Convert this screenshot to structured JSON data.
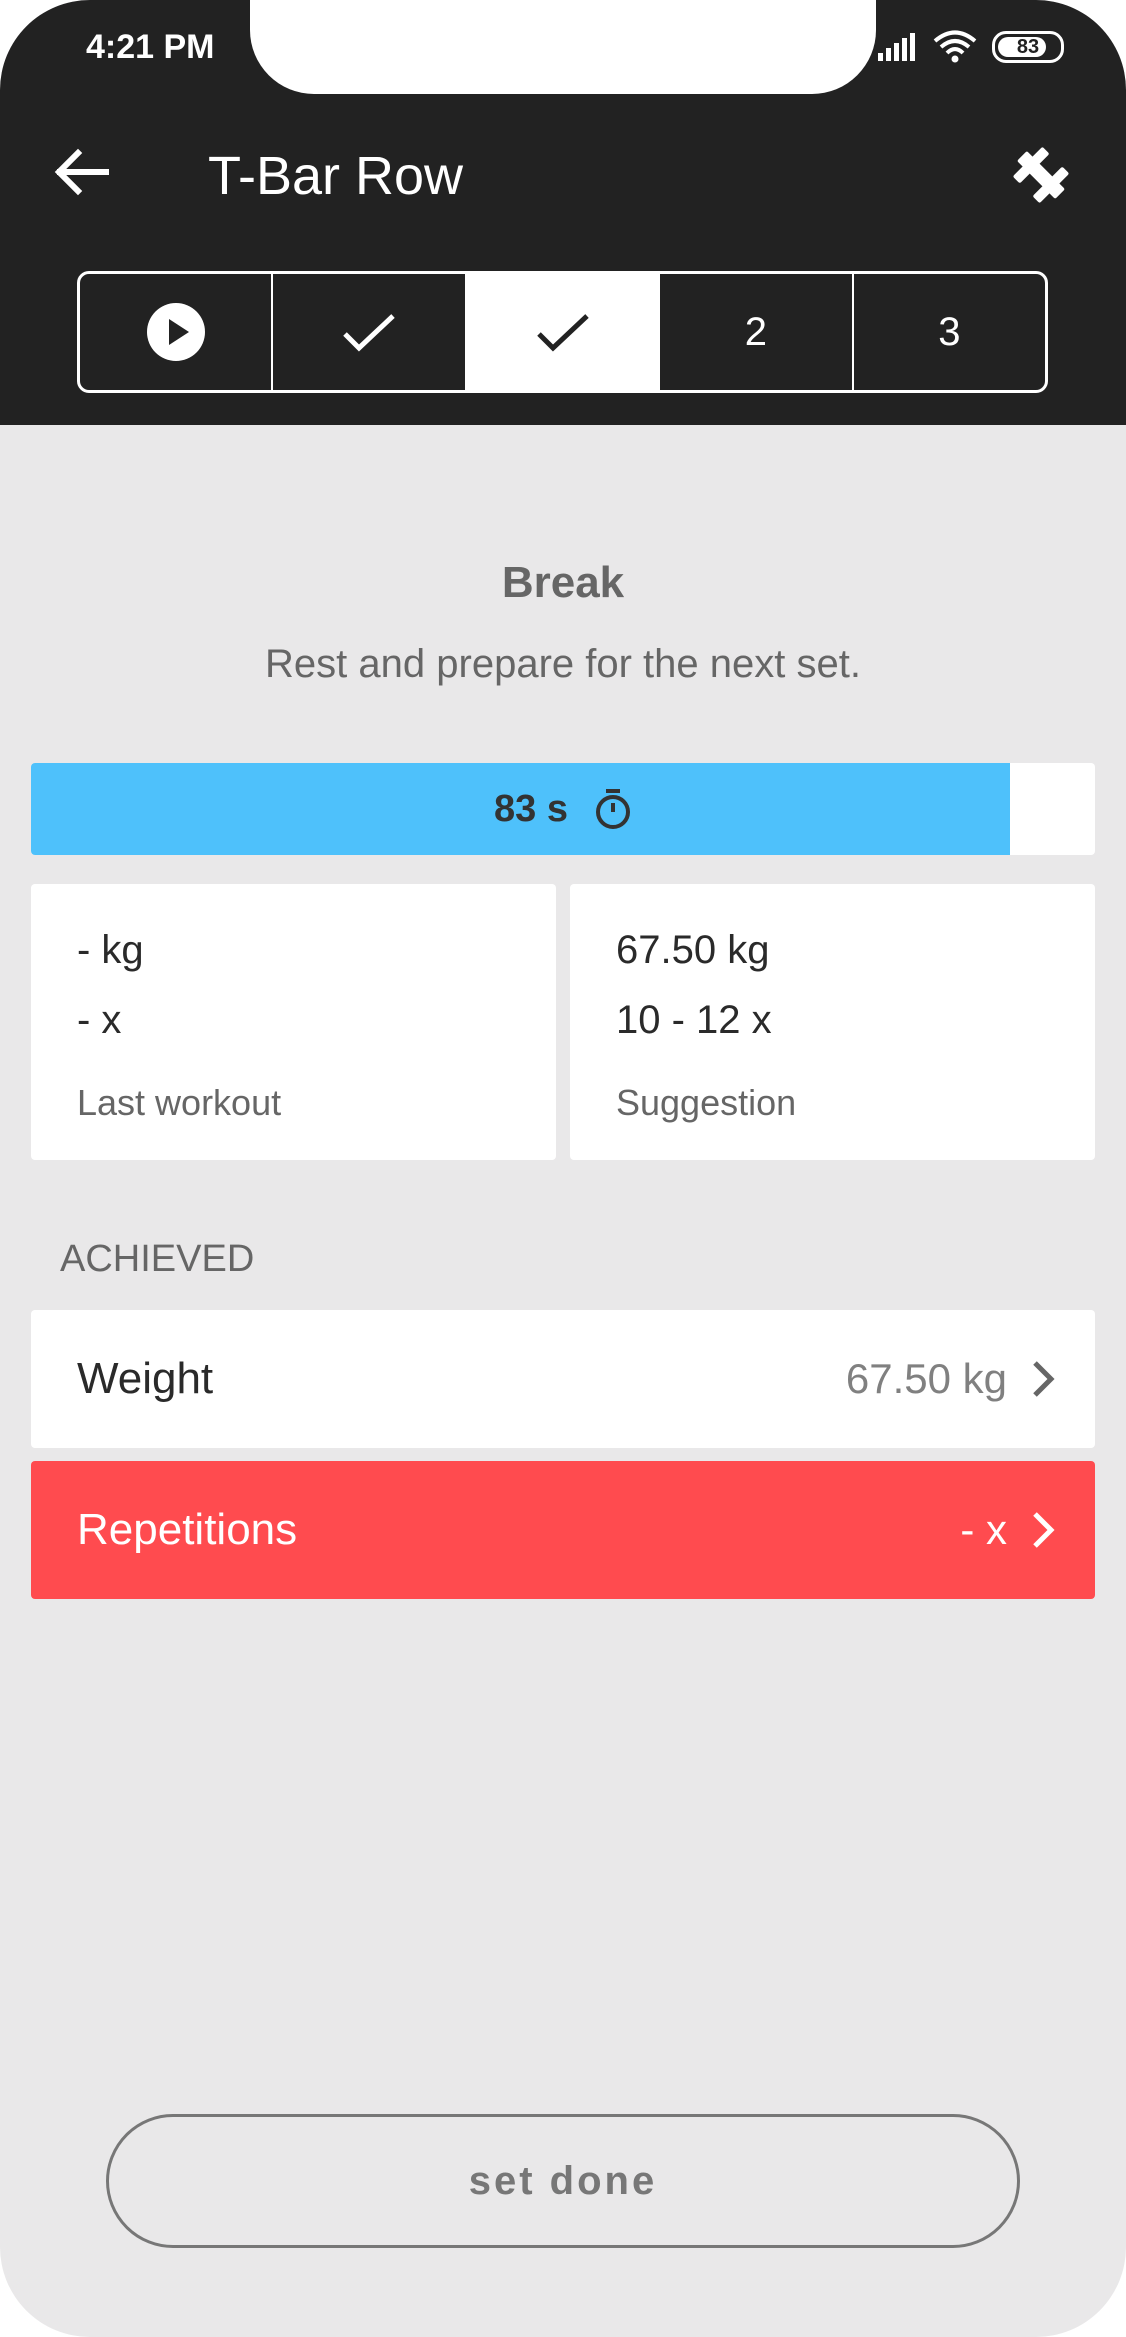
{
  "status_bar": {
    "time": "4:21 PM",
    "battery": "83"
  },
  "header": {
    "title": "T-Bar Row"
  },
  "set_tabs": [
    {
      "type": "play-icon",
      "label": "",
      "active": false
    },
    {
      "type": "check-icon",
      "label": "",
      "active": false
    },
    {
      "type": "check-icon",
      "label": "",
      "active": true
    },
    {
      "type": "text",
      "label": "2",
      "active": false
    },
    {
      "type": "text",
      "label": "3",
      "active": false
    }
  ],
  "break": {
    "title": "Break",
    "subtitle": "Rest and prepare for the next set."
  },
  "timer": {
    "label": "83 s",
    "progress": 0.92,
    "color": "#4ec1fb"
  },
  "last_workout": {
    "weight": "- kg",
    "reps": "- x",
    "caption": "Last workout"
  },
  "suggestion": {
    "weight": "67.50 kg",
    "reps": "10 - 12 x",
    "caption": "Suggestion"
  },
  "achieved": {
    "heading": "ACHIEVED",
    "weight": {
      "label": "Weight",
      "value": "67.50 kg"
    },
    "repetitions": {
      "label": "Repetitions",
      "value": "- x",
      "color": "#ff4b4f"
    }
  },
  "actions": {
    "set_done": "set done"
  }
}
